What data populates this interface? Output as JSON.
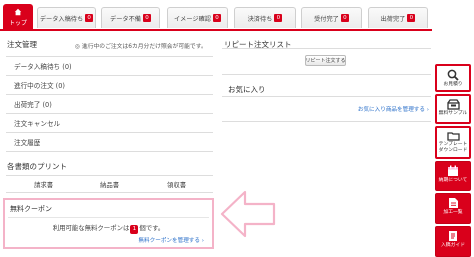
{
  "tabs": [
    {
      "label": "トップ",
      "badge": null
    },
    {
      "label": "データ入稿待ち",
      "badge": "0"
    },
    {
      "label": "データ不備",
      "badge": "0"
    },
    {
      "label": "イメージ確認",
      "badge": "0"
    },
    {
      "label": "決済待ち",
      "badge": "0"
    },
    {
      "label": "受付完了",
      "badge": "0"
    },
    {
      "label": "出荷完了",
      "badge": "0"
    }
  ],
  "order_management": {
    "title": "注文管理",
    "note": "◎ 進行中のご注文は6カ月分だけ照会が可能です。",
    "items": [
      {
        "label": "データ入稿待ち (0)"
      },
      {
        "label": "進行中の注文 (0)"
      },
      {
        "label": "出荷完了 (0)"
      },
      {
        "label": "注文キャンセル"
      },
      {
        "label": "注文履歴"
      }
    ]
  },
  "prints": {
    "title": "各書類のプリント",
    "items": [
      "請求書",
      "納品書",
      "領収書"
    ]
  },
  "coupon": {
    "title": "無料クーポン",
    "msg_before": "利用可能な無料クーポンは",
    "count": "1",
    "msg_after": "個です。",
    "link": "無料クーポンを管理する ›"
  },
  "repeat_orders": {
    "title": "リピート注文リスト",
    "button": "リピート注文する"
  },
  "favorites": {
    "title": "お気に入り",
    "link": "お気に入り商品を管理する ›"
  },
  "sidebar": {
    "items": [
      {
        "label": "お見積り",
        "icon": "search-icon",
        "style": "white"
      },
      {
        "label": "無料サンプル",
        "icon": "box-icon",
        "style": "white"
      },
      {
        "label": "テンプレート\nダウンロード",
        "icon": "folder-icon",
        "style": "white"
      },
      {
        "label": "納期について",
        "icon": "calendar-icon",
        "style": "red"
      },
      {
        "label": "加工一覧",
        "icon": "document-icon",
        "style": "red"
      },
      {
        "label": "入稿ガイド",
        "icon": "guide-icon",
        "style": "red"
      }
    ]
  },
  "colors": {
    "accent": "#d9001b",
    "link": "#2a6fc9",
    "highlight": "#f4b3c8"
  }
}
